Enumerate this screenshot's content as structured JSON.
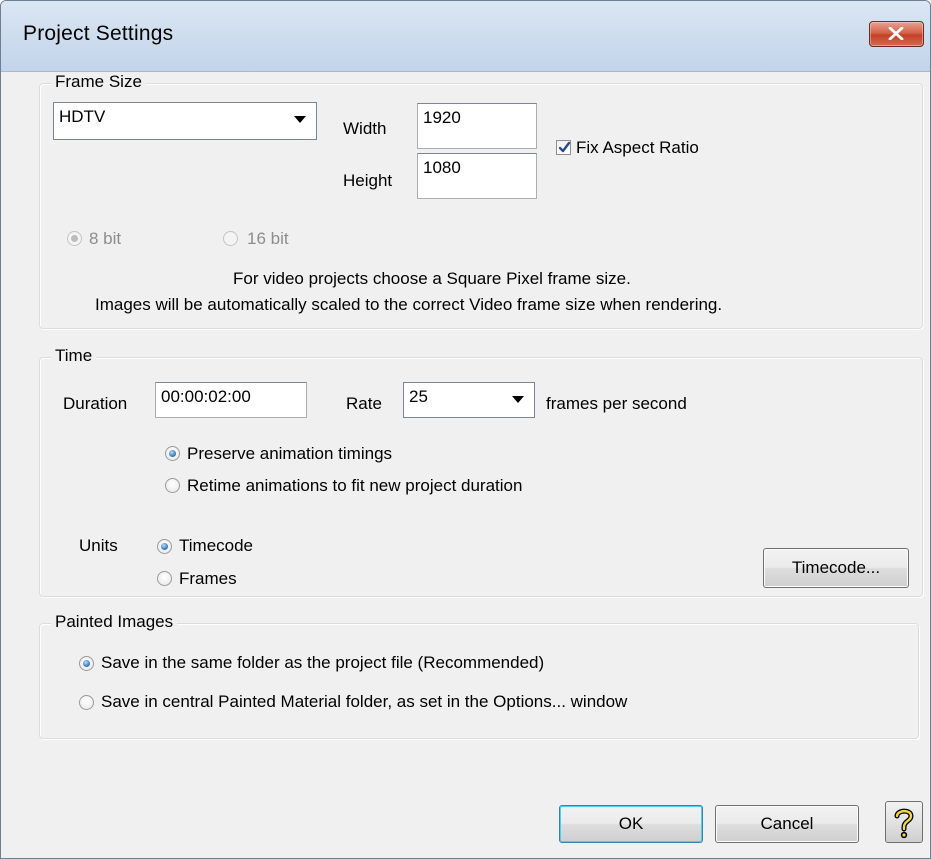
{
  "window": {
    "title": "Project Settings"
  },
  "frame_size": {
    "label": "Frame Size",
    "preset": "HDTV",
    "width_label": "Width",
    "width_value": "1920",
    "height_label": "Height",
    "height_value": "1080",
    "fix_aspect_label": "Fix Aspect Ratio",
    "fix_aspect_checked": true,
    "bit8_label": "8 bit",
    "bit16_label": "16 bit",
    "info_line1": "For video projects choose a Square Pixel frame size.",
    "info_line2": "Images will be automatically scaled to the correct Video frame size when rendering."
  },
  "time": {
    "label": "Time",
    "duration_label": "Duration",
    "duration_value": "00:00:02:00",
    "rate_label": "Rate",
    "rate_value": "25",
    "rate_suffix": "frames per second",
    "preserve_label": "Preserve animation timings",
    "retime_label": "Retime animations to fit new project duration",
    "units_label": "Units",
    "timecode_label": "Timecode",
    "frames_label": "Frames",
    "timecode_button": "Timecode..."
  },
  "painted_images": {
    "label": "Painted Images",
    "option_same_folder": "Save in the same folder as the project file (Recommended)",
    "option_central": "Save in central Painted Material folder, as set in the Options... window"
  },
  "buttons": {
    "ok": "OK",
    "cancel": "Cancel"
  },
  "icons": {
    "close": "close-icon",
    "help": "help-icon",
    "dropdown": "chevron-down-icon",
    "check": "check-icon"
  }
}
